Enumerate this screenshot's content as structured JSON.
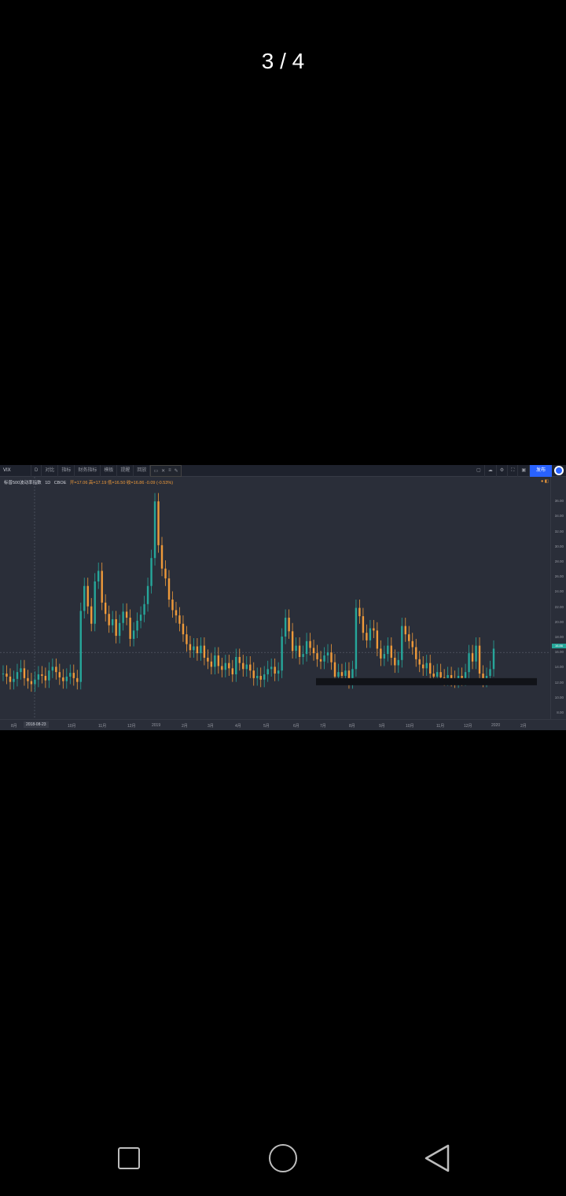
{
  "viewer": {
    "counter": "3 / 4"
  },
  "toolbar": {
    "symbol": "VIX",
    "interval": "D",
    "items": [
      "对比",
      "指标",
      "财务指标",
      "模板",
      "提醒",
      "回放"
    ],
    "right_items": [
      "",
      "",
      "",
      ""
    ],
    "publish_label": "发布"
  },
  "legend": {
    "name": "标普500波动率指数",
    "interval": "1D",
    "exchange": "CBOE",
    "ohlc": "开=17.06  高=17.19  低=16.50  收=16.86  -0.09 (-0.53%)"
  },
  "price_axis": {
    "ticks": [
      "36.00",
      "34.00",
      "32.00",
      "30.00",
      "28.00",
      "26.00",
      "24.00",
      "22.00",
      "20.00",
      "18.00",
      "16.00",
      "14.00",
      "12.00",
      "10.00",
      "8.00"
    ],
    "last_price": "16.86"
  },
  "time_axis": {
    "cursor_label": "2018-08-23",
    "ticks": [
      "8月",
      "10月",
      "11月",
      "12月",
      "2019",
      "2月",
      "3月",
      "4月",
      "5月",
      "6月",
      "7月",
      "8月",
      "9月",
      "10月",
      "11月",
      "12月",
      "2020",
      "2月"
    ]
  },
  "colors": {
    "up": "#26a69a",
    "down": "#ef9a3a",
    "bg": "#2a2e39",
    "accent": "#2962ff"
  },
  "chart_data": {
    "type": "line",
    "title": "标普500波动率指数",
    "ylim": [
      8,
      38
    ],
    "series": [
      {
        "name": "VIX",
        "values": [
          13.2,
          12.8,
          12.1,
          12.5,
          13.4,
          13.9,
          12.6,
          12.2,
          11.8,
          12.4,
          13.1,
          12.9,
          12.3,
          13.6,
          14.1,
          13.4,
          12.7,
          12.2,
          12.8,
          13.3,
          12.6,
          12.1,
          21.5,
          24.8,
          22.1,
          19.8,
          25.4,
          26.8,
          22.6,
          21.1,
          19.6,
          20.4,
          18.2,
          19.9,
          21.4,
          20.6,
          17.8,
          18.9,
          20.2,
          21.0,
          22.4,
          24.8,
          28.5,
          36.0,
          30.2,
          27.1,
          25.8,
          23.0,
          21.6,
          20.9,
          19.8,
          18.4,
          17.1,
          16.3,
          16.8,
          15.9,
          16.9,
          15.3,
          14.8,
          14.1,
          15.6,
          14.2,
          13.7,
          14.6,
          13.9,
          13.1,
          15.4,
          14.6,
          13.8,
          14.4,
          13.6,
          12.6,
          12.9,
          12.4,
          13.1,
          13.8,
          14.1,
          13.2,
          13.6,
          18.1,
          20.6,
          18.8,
          16.2,
          16.9,
          15.4,
          15.8,
          17.5,
          16.6,
          15.9,
          15.1,
          14.8,
          15.6,
          16.0,
          14.7,
          12.8,
          13.4,
          12.9,
          13.6,
          12.2,
          13.8,
          21.9,
          20.8,
          18.6,
          17.6,
          19.2,
          18.9,
          16.5,
          15.2,
          15.8,
          16.9,
          15.3,
          14.3,
          15.0,
          19.5,
          18.4,
          17.5,
          16.7,
          15.1,
          14.4,
          13.9,
          14.6,
          13.2,
          12.8,
          13.4,
          12.7,
          12.6,
          13.0,
          12.5,
          12.3,
          12.9,
          12.6,
          13.4,
          15.9,
          14.8,
          16.9,
          13.2,
          12.4,
          12.9,
          13.8,
          16.5
        ]
      }
    ]
  }
}
